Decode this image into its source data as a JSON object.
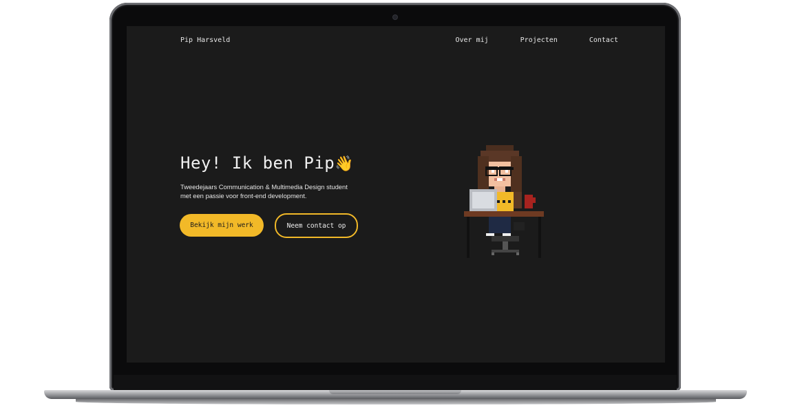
{
  "site": {
    "brand": "Pip Harsveld",
    "nav": [
      {
        "label": "Over mij"
      },
      {
        "label": "Projecten"
      },
      {
        "label": "Contact"
      }
    ]
  },
  "hero": {
    "title": "Hey! Ik ben Pip",
    "wave_icon": "waving-hand-icon",
    "subtitle_line1": "Tweedejaars Communication & Multimedia Design student",
    "subtitle_line2": "met een passie voor front-end development.",
    "primary_button": "Bekijk mijn werk",
    "secondary_button": "Neem contact op"
  },
  "colors": {
    "accent": "#f2b928",
    "background": "#1b1b1b",
    "text": "#f0f0f0"
  }
}
